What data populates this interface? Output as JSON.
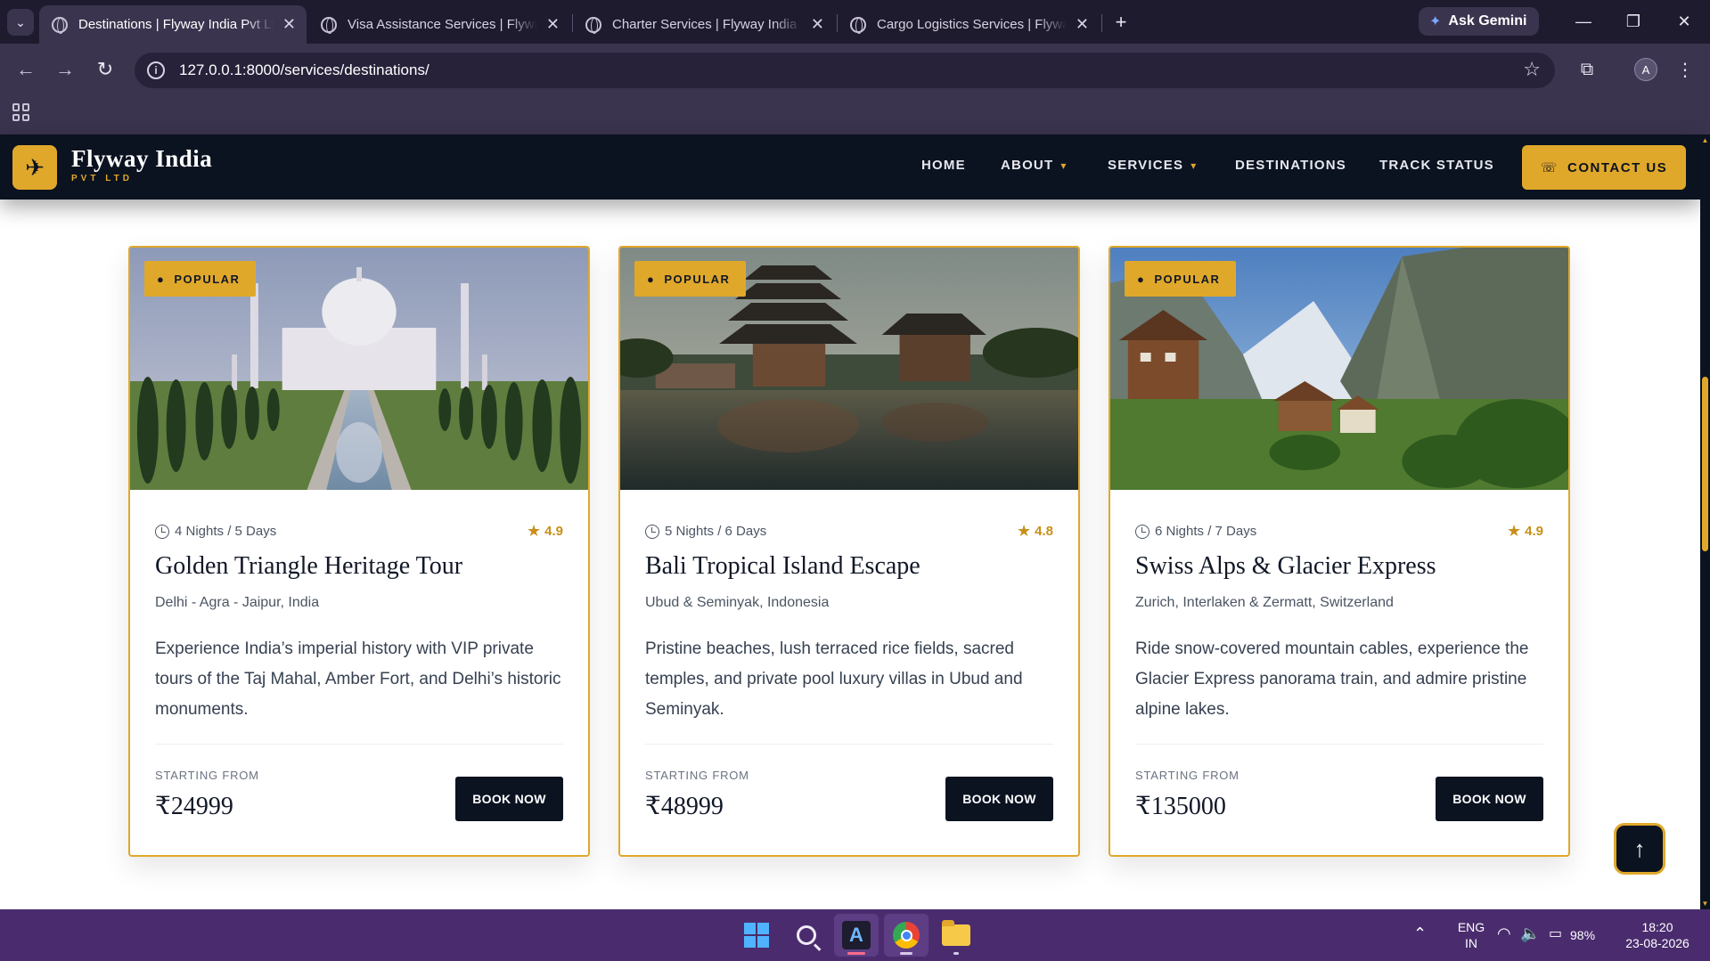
{
  "browser": {
    "tabs": [
      {
        "title": "Destinations | Flyway India Pvt Ltd",
        "active": true
      },
      {
        "title": "Visa Assistance Services | Flyway India",
        "active": false
      },
      {
        "title": "Charter Services | Flyway India Pvt Ltd",
        "active": false
      },
      {
        "title": "Cargo Logistics Services | Flyway India",
        "active": false
      }
    ],
    "gemini_label": "Ask Gemini",
    "url": "127.0.0.1:8000/services/destinations/",
    "profile_initial": "A"
  },
  "site": {
    "brand_name": "Flyway India",
    "brand_sub": "PVT LTD",
    "nav": {
      "home": "HOME",
      "about": "ABOUT",
      "services": "SERVICES",
      "destinations": "DESTINATIONS",
      "track": "TRACK STATUS"
    },
    "contact_label": "CONTACT US"
  },
  "cards": [
    {
      "badge": "POPULAR",
      "duration": "4 Nights / 5 Days",
      "rating": "4.9",
      "title": "Golden Triangle Heritage Tour",
      "location": "Delhi - Agra - Jaipur, India",
      "description": "Experience India’s imperial history with VIP private tours of the Taj Mahal, Amber Fort, and Delhi’s historic monuments.",
      "from_label": "STARTING FROM",
      "price": "₹24999",
      "book_label": "BOOK NOW"
    },
    {
      "badge": "POPULAR",
      "duration": "5 Nights / 6 Days",
      "rating": "4.8",
      "title": "Bali Tropical Island Escape",
      "location": "Ubud & Seminyak, Indonesia",
      "description": "Pristine beaches, lush terraced rice fields, sacred temples, and private pool luxury villas in Ubud and Seminyak.",
      "from_label": "STARTING FROM",
      "price": "₹48999",
      "book_label": "BOOK NOW"
    },
    {
      "badge": "POPULAR",
      "duration": "6 Nights / 7 Days",
      "rating": "4.9",
      "title": "Swiss Alps & Glacier Express",
      "location": "Zurich, Interlaken & Zermatt, Switzerland",
      "description": "Ride snow-covered mountain cables, experience the Glacier Express panorama train, and admire pristine alpine lakes.",
      "from_label": "STARTING FROM",
      "price": "₹135000",
      "book_label": "BOOK NOW"
    }
  ],
  "taskbar": {
    "lang_top": "ENG",
    "lang_bottom": "IN",
    "battery": "98%",
    "time": "18:20",
    "date": "23-08-2026"
  },
  "colors": {
    "gold": "#e0a82b",
    "navy": "#0b1220",
    "chrome_bg": "#1f1b2e",
    "toolbar_bg": "#3b344f",
    "taskbar_bg": "#4a2c6e"
  }
}
